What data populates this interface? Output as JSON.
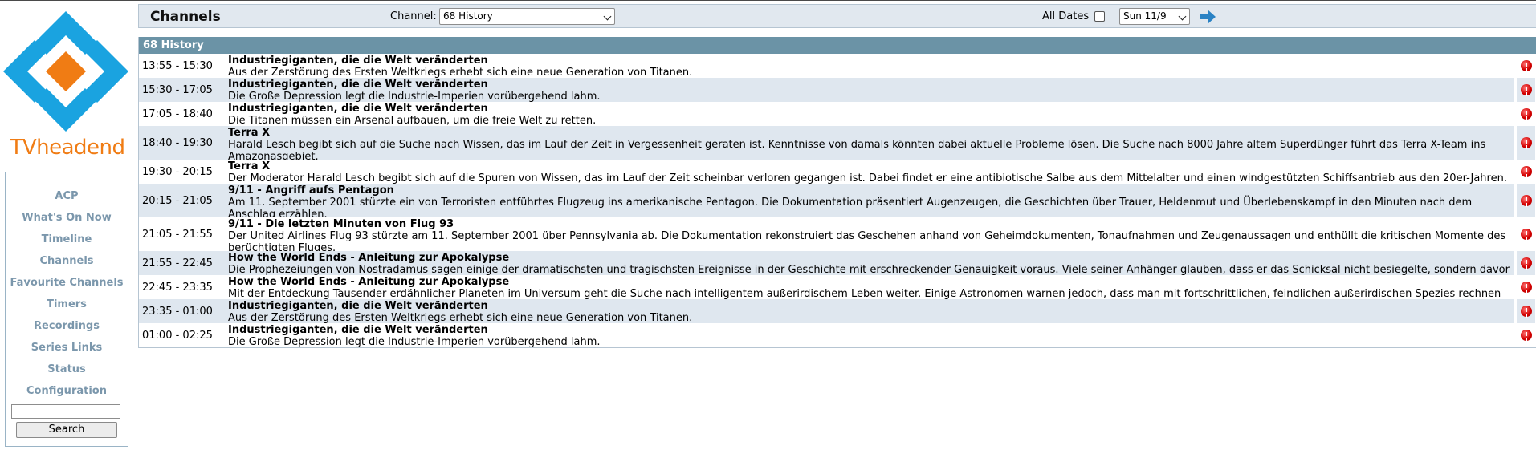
{
  "sidebar": {
    "logo_text": "TVheadend",
    "menu": [
      "ACP",
      "What's On Now",
      "Timeline",
      "Channels",
      "Favourite Channels",
      "Timers",
      "Recordings",
      "Series Links",
      "Status",
      "Configuration"
    ],
    "search_value": "",
    "search_button": "Search"
  },
  "header": {
    "title": "Channels",
    "channel_label": "Channel:",
    "channel_selected": "68 History",
    "all_dates_label": "All Dates",
    "all_dates_checked": false,
    "date_selected": "Sun 11/9"
  },
  "epg": {
    "channel_name": "68 History",
    "rows": [
      {
        "time": "13:55 - 15:30",
        "title": "Industriegiganten, die die Welt veränderten",
        "desc": "Aus der Zerstörung des Ersten Weltkriegs erhebt sich eine neue Generation von Titanen."
      },
      {
        "time": "15:30 - 17:05",
        "title": "Industriegiganten, die die Welt veränderten",
        "desc": "Die Große Depression legt die Industrie-Imperien vorübergehend lahm."
      },
      {
        "time": "17:05 - 18:40",
        "title": "Industriegiganten, die die Welt veränderten",
        "desc": "Die Titanen müssen ein Arsenal aufbauen, um die freie Welt zu retten."
      },
      {
        "time": "18:40 - 19:30",
        "title": "Terra X",
        "desc": "Harald Lesch begibt sich auf die Suche nach Wissen, das im Lauf der Zeit in Vergessenheit geraten ist. Kenntnisse von damals könnten dabei aktuelle Probleme lösen. Die Suche nach 8000 Jahre altem Superdünger führt das Terra X-Team ins Amazonasgebiet."
      },
      {
        "time": "19:30 - 20:15",
        "title": "Terra X",
        "desc": "Der Moderator Harald Lesch begibt sich auf die Spuren von Wissen, das im Lauf der Zeit scheinbar verloren gegangen ist. Dabei findet er eine antibiotische Salbe aus dem Mittelalter und einen windgestützten Schiffsantrieb aus den 20er-Jahren."
      },
      {
        "time": "20:15 - 21:05",
        "title": "9/11 - Angriff aufs Pentagon",
        "desc": "Am 11. September 2001 stürzte ein von Terroristen entführtes Flugzeug ins amerikanische Pentagon. Die Dokumentation präsentiert Augenzeugen, die Geschichten über Trauer, Heldenmut und Überlebenskampf in den Minuten nach dem Anschlag erzählen."
      },
      {
        "time": "21:05 - 21:55",
        "title": "9/11 - Die letzten Minuten von Flug 93",
        "desc": "Der United Airlines Flug 93 stürzte am 11. September 2001 über Pennsylvania ab. Die Dokumentation rekonstruiert das Geschehen anhand von Geheimdokumenten, Tonaufnahmen und Zeugenaussagen und enthüllt die kritischen Momente des berüchtigten Fluges."
      },
      {
        "time": "21:55 - 22:45",
        "title": "How the World Ends - Anleitung zur Apokalypse",
        "desc": "Die Prophezeiungen von Nostradamus sagen einige der dramatischsten und tragischsten Ereignisse in der Geschichte mit erschreckender Genauigkeit voraus. Viele seiner Anhänger glauben, dass er das Schicksal nicht besiegelte, sondern davor warnte."
      },
      {
        "time": "22:45 - 23:35",
        "title": "How the World Ends - Anleitung zur Apokalypse",
        "desc": "Mit der Entdeckung Tausender erdähnlicher Planeten im Universum geht die Suche nach intelligentem außerirdischem Leben weiter. Einige Astronomen warnen jedoch, dass man mit fortschrittlichen, feindlichen außerirdischen Spezies rechnen muss."
      },
      {
        "time": "23:35 - 01:00",
        "title": "Industriegiganten, die die Welt veränderten",
        "desc": "Aus der Zerstörung des Ersten Weltkriegs erhebt sich eine neue Generation von Titanen."
      },
      {
        "time": "01:00 - 02:25",
        "title": "Industriegiganten, die die Welt veränderten",
        "desc": "Die Große Depression legt die Industrie-Imperien vorübergehend lahm."
      }
    ]
  },
  "icons": {
    "record": "record-icon",
    "next": "arrow-right-icon",
    "dropdown": "chevron-down-icon"
  },
  "colors": {
    "accent_blue": "#1aa3e0",
    "logo_orange": "#f07c14",
    "header_bar": "#6b93a6",
    "row_alt": "#dfe7ef",
    "menu_text": "#7b97ac",
    "record_red": "#d40000"
  }
}
